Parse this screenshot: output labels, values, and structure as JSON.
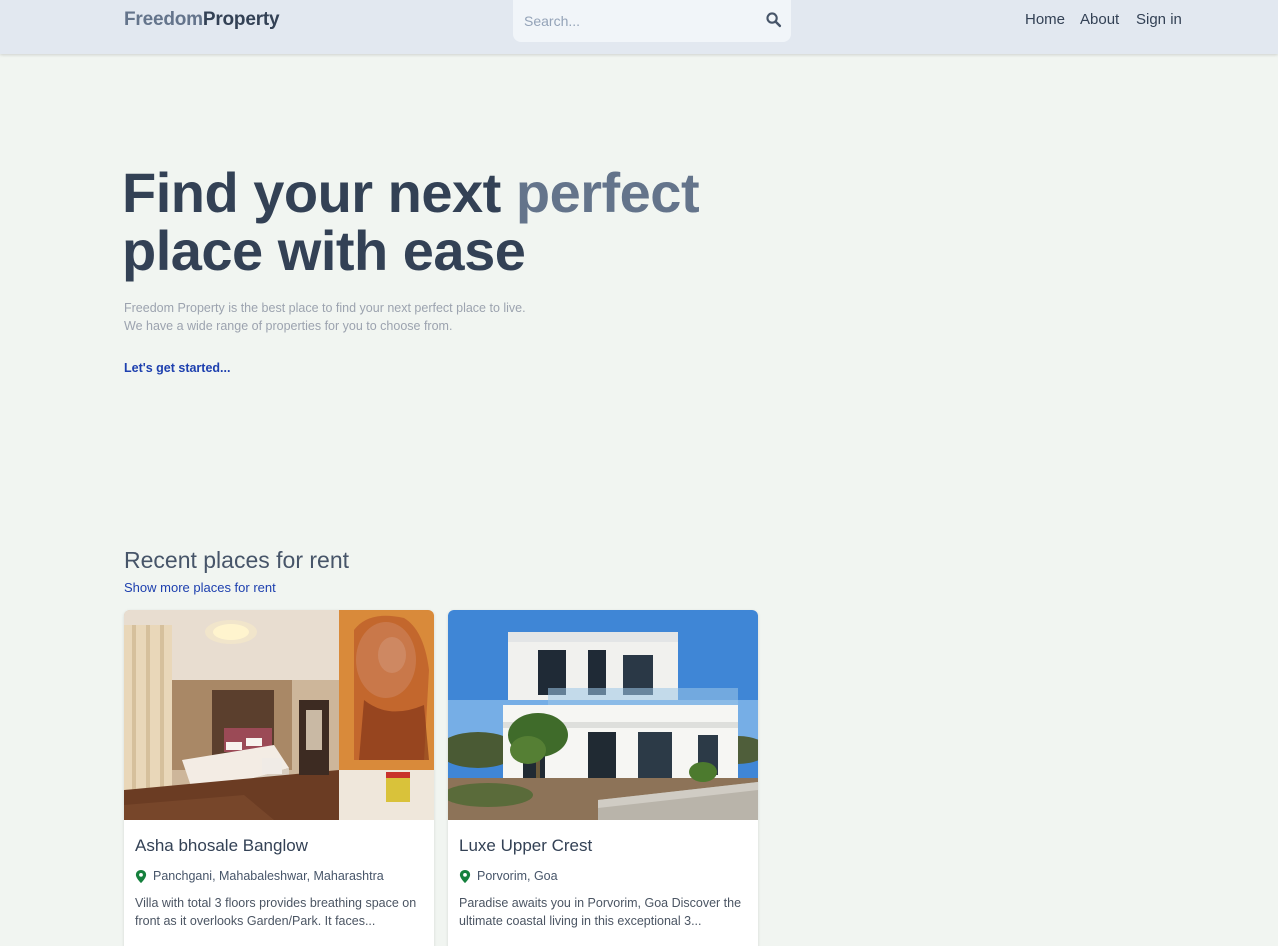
{
  "header": {
    "logo_part1": "Freedom",
    "logo_part2": "Property",
    "search_placeholder": "Search...",
    "search_icon": "search-icon",
    "nav": {
      "home": "Home",
      "about": "About",
      "signin": "Sign in"
    }
  },
  "hero": {
    "title_line1_start": "Find your next ",
    "title_accent": "perfect",
    "title_line2": "place with ease",
    "description_line1": "Freedom Property is the best place to find your next perfect place to live.",
    "description_line2": "We have a wide range of properties for you to choose from.",
    "cta": "Let's get started..."
  },
  "recent": {
    "title": "Recent places for rent",
    "more_link": "Show more places for rent",
    "listings": [
      {
        "name": "Asha bhosale Banglow",
        "location": "Panchgani, Mahabaleshwar, Maharashtra",
        "description": "Villa with total 3 floors provides breathing space on front as it overlooks Garden/Park. It faces...",
        "image": "bedroom-interior-photo"
      },
      {
        "name": "Luxe Upper Crest",
        "location": "Porvorim, Goa",
        "description": "Paradise awaits you in Porvorim, Goa Discover the ultimate coastal living in this exceptional 3...",
        "image": "modern-villa-exterior-photo"
      }
    ]
  },
  "colors": {
    "page_background": "#f1f5f1",
    "header_background": "#e2e8f0",
    "text_primary": "#334155",
    "text_accent": "#64748b",
    "link": "#1e40af",
    "pin_icon": "#15803d"
  }
}
